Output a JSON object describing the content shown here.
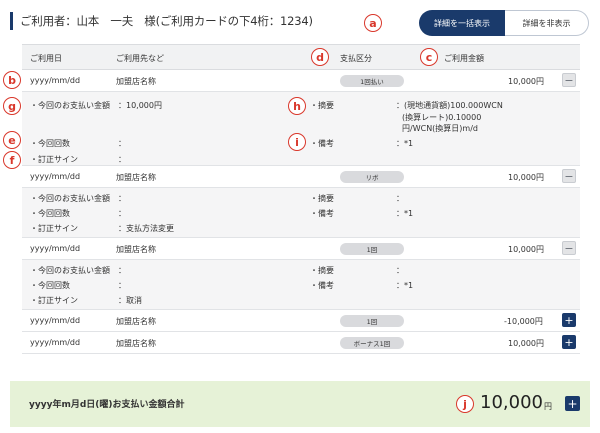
{
  "header": {
    "title": "ご利用者：山本　一夫　様(ご利用カードの下4桁：1234)",
    "show_all_label": "詳細を一括表示",
    "hide_all_label": "詳細を非表示"
  },
  "markers": {
    "a": "a",
    "b": "b",
    "c": "c",
    "d": "d",
    "e": "e",
    "f": "f",
    "g": "g",
    "h": "h",
    "i": "i",
    "j": "j"
  },
  "table": {
    "columns": {
      "date": "ご利用日",
      "merchant": "ご利用先など",
      "payment_type": "支払区分",
      "amount": "ご利用金額"
    },
    "detail_labels": {
      "current_payment": "・今回のお支払い金額",
      "current_count": "・今回回数",
      "correction_sign": "・訂正サイン",
      "summary": "・摘要",
      "remarks": "・備考"
    },
    "rows": [
      {
        "date": "yyyy/mm/dd",
        "merchant": "加盟店名称",
        "payment_type": "1回払い",
        "amount": "10,000円",
        "expanded": true,
        "detail": {
          "current_payment": "：10,000円",
          "current_count": "：",
          "correction_sign": "：",
          "summary_1": "：(現地通貨額)100.000WCN",
          "summary_2": "(換算レート)0.10000",
          "summary_3": "円/WCN(換算日)m/d",
          "remarks": "：*1"
        }
      },
      {
        "date": "yyyy/mm/dd",
        "merchant": "加盟店名称",
        "payment_type": "リボ",
        "amount": "10,000円",
        "expanded": true,
        "detail": {
          "current_payment": "：",
          "current_count": "：",
          "correction_sign": "：支払方法変更",
          "summary": "：",
          "remarks": "：*1"
        }
      },
      {
        "date": "yyyy/mm/dd",
        "merchant": "加盟店名称",
        "payment_type": "1回",
        "amount": "10,000円",
        "expanded": true,
        "detail": {
          "current_payment": "：",
          "current_count": "：",
          "correction_sign": "：取消",
          "summary": "：",
          "remarks": "：*1"
        }
      },
      {
        "date": "yyyy/mm/dd",
        "merchant": "加盟店名称",
        "payment_type": "1回",
        "amount": "-10,000円",
        "expanded": false
      },
      {
        "date": "yyyy/mm/dd",
        "merchant": "加盟店名称",
        "payment_type": "ボーナス1回",
        "amount": "10,000円",
        "expanded": false
      }
    ],
    "toggle_expanded": "−",
    "toggle_collapsed": "+"
  },
  "total": {
    "label": "yyyy年m月d日(曜)お支払い金額合計",
    "amount": "10,000",
    "unit": "円",
    "toggle": "+"
  },
  "colors": {
    "primary": "#1a3a6b",
    "marker": "#d9372b",
    "total_bg": "#e6f2d7",
    "header_bg": "#f1f2f3",
    "detail_bg": "#f5f5f6"
  }
}
